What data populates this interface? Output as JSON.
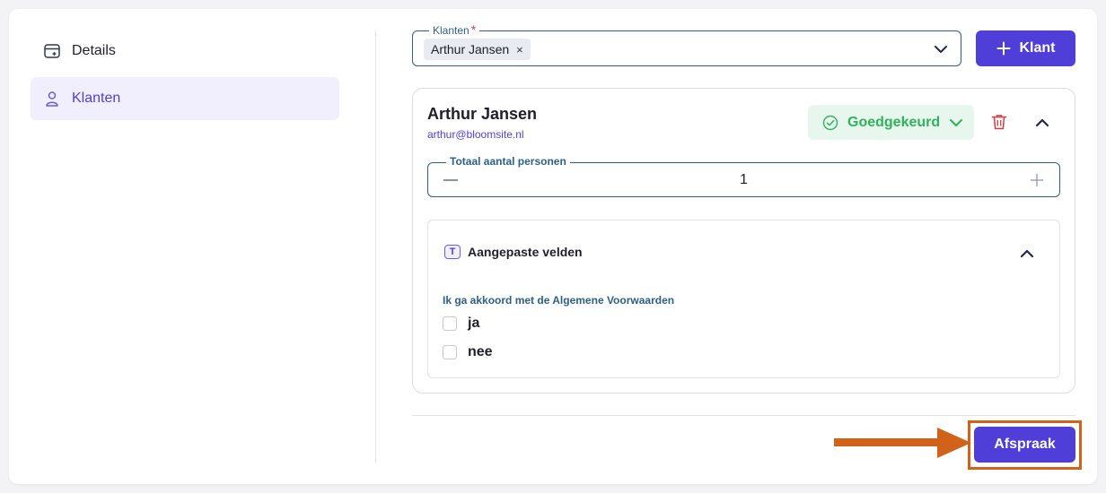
{
  "sidebar": {
    "items": [
      {
        "label": "Details",
        "icon": "calendar-add-icon",
        "active": false
      },
      {
        "label": "Klanten",
        "icon": "user-icon",
        "active": true
      }
    ]
  },
  "clients_field": {
    "label": "Klanten",
    "required_mark": "*",
    "selected_chip": "Arthur Jansen",
    "chip_remove": "×"
  },
  "add_client_button": {
    "label": "Klant",
    "icon": "plus-icon"
  },
  "client_card": {
    "name": "Arthur Jansen",
    "email": "arthur@bloomsite.nl",
    "status": "Goedgekeurd",
    "status_color": "#2fb35a",
    "persons_field": {
      "label": "Totaal aantal personen",
      "value": "1"
    },
    "custom_fields": {
      "title": "Aangepaste velden",
      "icon_letter": "T",
      "question": "Ik ga akkoord met de Algemene Voorwaarden",
      "options": [
        "ja",
        "nee"
      ]
    }
  },
  "submit_button": {
    "label": "Afspraak"
  },
  "colors": {
    "accent": "#4f3fd8",
    "annotation": "#d2621a",
    "danger": "#e03a3a"
  }
}
